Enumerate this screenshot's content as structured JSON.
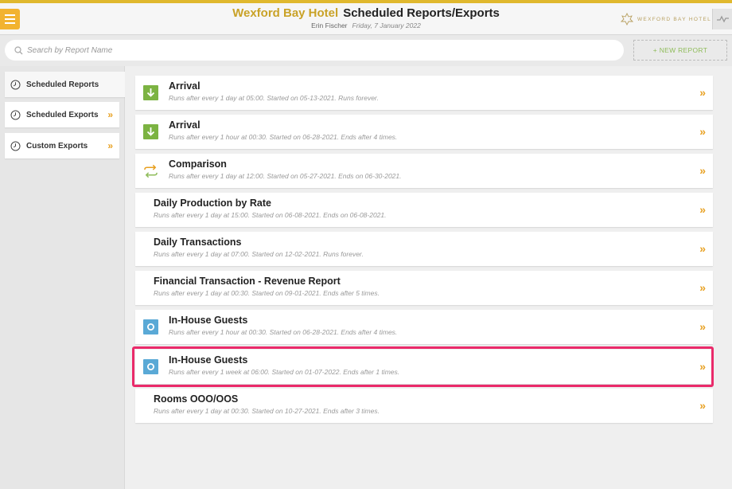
{
  "header": {
    "hotel_name": "Wexford Bay Hotel",
    "page_title": "Scheduled Reports/Exports",
    "user": "Erin Fischer",
    "date": "Friday, 7 January 2022",
    "brand": "WEXFORD BAY HOTEL"
  },
  "search": {
    "placeholder": "Search by Report Name",
    "value": ""
  },
  "new_report_label": "+ NEW REPORT",
  "sidebar": {
    "items": [
      {
        "label": "Scheduled Reports"
      },
      {
        "label": "Scheduled Exports"
      },
      {
        "label": "Custom Exports"
      }
    ]
  },
  "reports": [
    {
      "name": "Arrival",
      "desc": "Runs after every 1 day at 05:00. Started on 05-13-2021. Runs forever.",
      "icon": "download-icon"
    },
    {
      "name": "Arrival",
      "desc": "Runs after every 1 hour at 00:30. Started on 06-28-2021. Ends after 4 times.",
      "icon": "download-icon"
    },
    {
      "name": "Comparison",
      "desc": "Runs after every 1 day at 12:00. Started on 05-27-2021. Ends on 06-30-2021.",
      "icon": "swap-icon"
    },
    {
      "name": "Daily Production by Rate",
      "desc": "Runs after every 1 day at 15:00. Started on 06-08-2021. Ends on 06-08-2021.",
      "icon": ""
    },
    {
      "name": "Daily Transactions",
      "desc": "Runs after every 1 day at 07:00. Started on 12-02-2021. Runs forever.",
      "icon": ""
    },
    {
      "name": "Financial Transaction - Revenue Report",
      "desc": "Runs after every 1 day at 00:30. Started on 09-01-2021. Ends after 5 times.",
      "icon": ""
    },
    {
      "name": "In-House Guests",
      "desc": "Runs after every 1 hour at 00:30. Started on 06-28-2021. Ends after 4 times.",
      "icon": "circle-icon"
    },
    {
      "name": "In-House Guests",
      "desc": "Runs after every 1 week at 06:00. Started on 01-07-2022. Ends after 1 times.",
      "icon": "circle-icon"
    },
    {
      "name": "Rooms OOO/OOS",
      "desc": "Runs after every 1 day at 00:30. Started on 10-27-2021. Ends after 3 times.",
      "icon": ""
    }
  ],
  "colors": {
    "accent_gold": "#c9a227",
    "chevron_orange": "#e8a020",
    "download_green": "#7cb342",
    "circle_blue": "#5aa9d6",
    "highlight_pink": "#ea2a6a",
    "new_report_green": "#8fbc5a"
  }
}
